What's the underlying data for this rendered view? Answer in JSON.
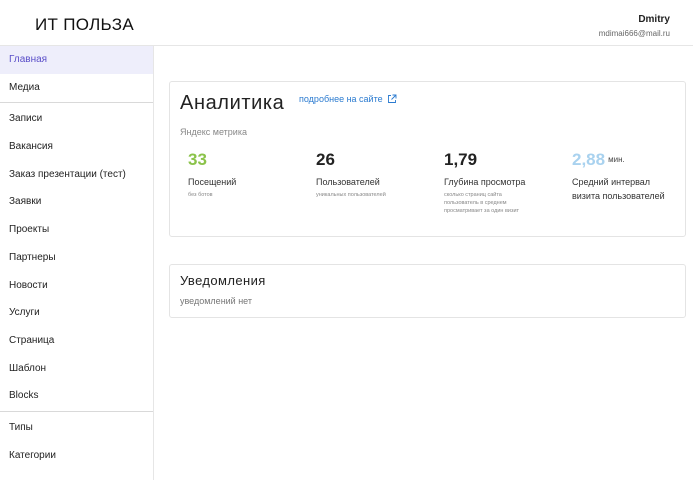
{
  "app": {
    "brand": "ИТ ПОЛЬЗА",
    "user": {
      "name": "Dmitry",
      "email": "mdimai666@mail.ru"
    }
  },
  "sidebar": {
    "groups": [
      [
        {
          "label": "Главная",
          "active": true
        },
        {
          "label": "Медиа"
        }
      ],
      [
        {
          "label": "Записи"
        },
        {
          "label": "Вакансия"
        },
        {
          "label": "Заказ презентации (тест)"
        },
        {
          "label": "Заявки"
        },
        {
          "label": "Проекты"
        },
        {
          "label": "Партнеры"
        },
        {
          "label": "Новости"
        },
        {
          "label": "Услуги"
        },
        {
          "label": "Страница"
        },
        {
          "label": "Шаблон"
        },
        {
          "label": "Blocks"
        }
      ],
      [
        {
          "label": "Типы"
        },
        {
          "label": "Категории"
        }
      ]
    ]
  },
  "analytics": {
    "title": "Аналитика",
    "more_link": "подробнее на сайте",
    "source_label": "Яндекс метрика",
    "stats": [
      {
        "value": "33",
        "label": "Посещений",
        "sub": "без ботов",
        "color": "#8bc34a"
      },
      {
        "value": "26",
        "label": "Пользователей",
        "sub": "уникальных пользователей",
        "color": "#222222"
      },
      {
        "value": "1,79",
        "label": "Глубина просмотра",
        "sub": "сколько страниц сайта пользователь в среднем просматривает за один визит",
        "color": "#222222"
      },
      {
        "value": "2,88",
        "unit": "мин.",
        "label": "Средний интервал визита пользователей",
        "sub": "",
        "color": "#a9d2ef"
      }
    ]
  },
  "notifications": {
    "title": "Уведомления",
    "empty_text": "уведомлений нет"
  },
  "icons": {
    "external_link": "external-link-icon"
  }
}
